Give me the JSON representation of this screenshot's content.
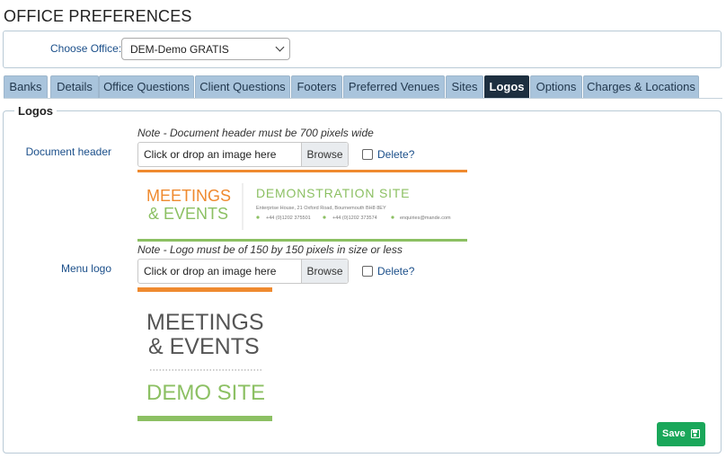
{
  "page": {
    "title": "OFFICE PREFERENCES"
  },
  "office": {
    "label": "Choose Office:",
    "selected": "DEM-Demo GRATIS"
  },
  "tabs": [
    {
      "label": "Banks"
    },
    {
      "label": "Details"
    },
    {
      "label": "Office Questions"
    },
    {
      "label": "Client Questions"
    },
    {
      "label": "Footers"
    },
    {
      "label": "Preferred Venues"
    },
    {
      "label": "Sites"
    },
    {
      "label": "Logos",
      "active": true
    },
    {
      "label": "Options"
    },
    {
      "label": "Charges & Locations"
    }
  ],
  "logos": {
    "legend": "Logos",
    "document_header": {
      "label": "Document header",
      "note": "Note - Document header must be 700 pixels wide",
      "placeholder": "Click or drop an image here",
      "browse": "Browse",
      "delete": "Delete?",
      "preview": {
        "line1": "MEETINGS",
        "line2": "& EVENTS",
        "site": "DEMONSTRATION SITE",
        "address": "Enterprise House, 21 Oxford Road, Bournemouth BH8 8EY",
        "phone1": "+44 (0)1202 375501",
        "phone2": "+44 (0)1202 373574",
        "email": "enquiries@mande.com"
      }
    },
    "menu_logo": {
      "label": "Menu logo",
      "note": "Note - Logo must be of 150 by 150 pixels in size or less",
      "placeholder": "Click or drop an image here",
      "browse": "Browse",
      "delete": "Delete?",
      "preview": {
        "line1": "MEETINGS",
        "line2": "& EVENTS",
        "line3": "DEMO SITE"
      }
    },
    "save": "Save"
  },
  "colors": {
    "orange": "#ef8a2f",
    "green": "#8cc063",
    "active_tab": "#1d2f40",
    "tab": "#a9c4dc",
    "save": "#1aa75a"
  }
}
